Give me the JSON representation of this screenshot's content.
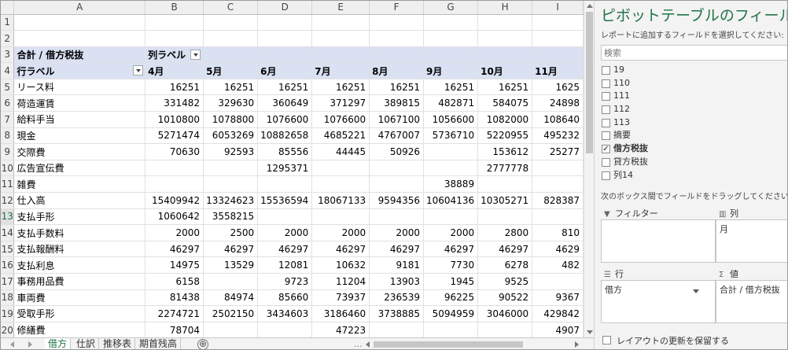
{
  "columns": [
    "A",
    "B",
    "C",
    "D",
    "E",
    "F",
    "G",
    "H",
    "I"
  ],
  "rows": [
    {
      "n": "1",
      "cells": [
        "",
        "",
        "",
        "",
        "",
        "",
        "",
        "",
        ""
      ]
    },
    {
      "n": "2",
      "cells": [
        "",
        "",
        "",
        "",
        "",
        "",
        "",
        "",
        ""
      ]
    },
    {
      "n": "3",
      "cells": [
        "合計 / 借方税抜",
        "列ラベル",
        "",
        "",
        "",
        "",
        "",
        "",
        ""
      ]
    },
    {
      "n": "4",
      "cells": [
        "行ラベル",
        "4月",
        "5月",
        "6月",
        "7月",
        "8月",
        "9月",
        "10月",
        "11月"
      ]
    },
    {
      "n": "5",
      "cells": [
        "リース料",
        "16251",
        "16251",
        "16251",
        "16251",
        "16251",
        "16251",
        "16251",
        "1625"
      ]
    },
    {
      "n": "6",
      "cells": [
        "荷造運賃",
        "331482",
        "329630",
        "360649",
        "371297",
        "389815",
        "482871",
        "584075",
        "24898"
      ]
    },
    {
      "n": "7",
      "cells": [
        "給料手当",
        "1010800",
        "1078800",
        "1076600",
        "1076600",
        "1067100",
        "1056600",
        "1082000",
        "108640"
      ]
    },
    {
      "n": "8",
      "cells": [
        "現金",
        "5271474",
        "6053269",
        "10882658",
        "4685221",
        "4767007",
        "5736710",
        "5220955",
        "495232"
      ]
    },
    {
      "n": "9",
      "cells": [
        "交際費",
        "70630",
        "92593",
        "85556",
        "44445",
        "50926",
        "",
        "153612",
        "25277"
      ]
    },
    {
      "n": "10",
      "cells": [
        "広告宣伝費",
        "",
        "",
        "1295371",
        "",
        "",
        "",
        "2777778",
        ""
      ]
    },
    {
      "n": "11",
      "cells": [
        "雑費",
        "",
        "",
        "",
        "",
        "",
        "38889",
        "",
        ""
      ]
    },
    {
      "n": "12",
      "cells": [
        "仕入高",
        "15409942",
        "13324623",
        "15536594",
        "18067133",
        "9594356",
        "10604136",
        "10305271",
        "828387"
      ]
    },
    {
      "n": "13",
      "cells": [
        "支払手形",
        "1060642",
        "3558215",
        "",
        "",
        "",
        "",
        "",
        ""
      ]
    },
    {
      "n": "14",
      "cells": [
        "支払手数料",
        "2000",
        "2500",
        "2000",
        "2000",
        "2000",
        "2000",
        "2800",
        "810"
      ]
    },
    {
      "n": "15",
      "cells": [
        "支払報酬料",
        "46297",
        "46297",
        "46297",
        "46297",
        "46297",
        "46297",
        "46297",
        "4629"
      ]
    },
    {
      "n": "16",
      "cells": [
        "支払利息",
        "14975",
        "13529",
        "12081",
        "10632",
        "9181",
        "7730",
        "6278",
        "482"
      ]
    },
    {
      "n": "17",
      "cells": [
        "事務用品費",
        "6158",
        "",
        "9723",
        "11204",
        "13903",
        "1945",
        "9525",
        ""
      ]
    },
    {
      "n": "18",
      "cells": [
        "車両費",
        "81438",
        "84974",
        "85660",
        "73937",
        "236539",
        "96225",
        "90522",
        "9367"
      ]
    },
    {
      "n": "19",
      "cells": [
        "受取手形",
        "2274721",
        "2502150",
        "3434603",
        "3186460",
        "3738885",
        "5094959",
        "3046000",
        "429842"
      ]
    },
    {
      "n": "20",
      "cells": [
        "修繕費",
        "78704",
        "",
        "",
        "47223",
        "",
        "",
        "",
        "4907"
      ]
    }
  ],
  "tabs": [
    "借方",
    "仕訳",
    "推移表",
    "期首残高"
  ],
  "tabs_more": "...",
  "add_sheet": "⊕",
  "pane": {
    "title": "ピボットテーブルのフィールド",
    "subtitle": "レポートに追加するフィールドを選択してください:",
    "search_placeholder": "検索",
    "fields": [
      {
        "label": "19",
        "checked": false
      },
      {
        "label": "110",
        "checked": false
      },
      {
        "label": "111",
        "checked": false
      },
      {
        "label": "112",
        "checked": false
      },
      {
        "label": "113",
        "checked": false
      },
      {
        "label": "摘要",
        "checked": false
      },
      {
        "label": "借方税抜",
        "checked": true
      },
      {
        "label": "貸方税抜",
        "checked": false
      },
      {
        "label": "列14",
        "checked": false
      }
    ],
    "drag_hint": "次のボックス間でフィールドをドラッグしてください:",
    "filter_label": "フィルター",
    "column_label": "列",
    "row_label": "行",
    "value_label": "値",
    "column_item": "月",
    "row_item": "借方",
    "value_item": "合計 / 借方税抜",
    "defer_label": "レイアウトの更新を保留する"
  },
  "icons": {
    "filter": "filter-icon",
    "column": "columns-icon",
    "row": "rows-icon",
    "value": "sigma-icon"
  },
  "colors": {
    "accent": "#217346",
    "pivot_header": "#d9e1f2",
    "selected_row": "#1d7044"
  }
}
